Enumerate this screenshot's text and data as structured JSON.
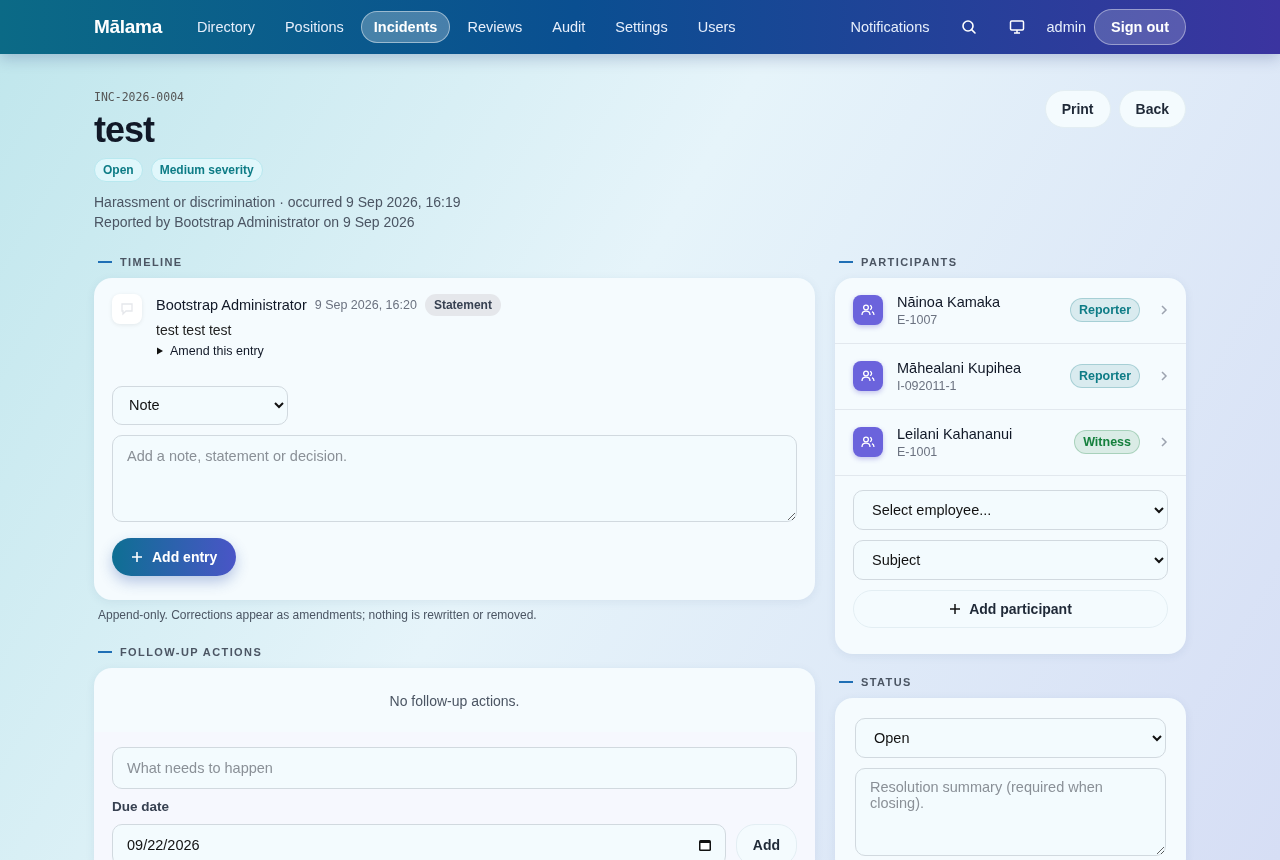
{
  "nav": {
    "brand": "Mālama",
    "items": [
      {
        "label": "Directory",
        "selected": false
      },
      {
        "label": "Positions",
        "selected": false
      },
      {
        "label": "Incidents",
        "selected": true
      },
      {
        "label": "Reviews",
        "selected": false
      },
      {
        "label": "Audit",
        "selected": false
      },
      {
        "label": "Settings",
        "selected": false
      },
      {
        "label": "Users",
        "selected": false
      }
    ],
    "notifications": "Notifications",
    "user": "admin",
    "sign_out": "Sign out"
  },
  "header": {
    "ref": "INC-2026-0004",
    "title": "test",
    "badges": [
      "Open",
      "Medium severity"
    ],
    "meta": "Harassment or discrimination · occurred 9 Sep 2026, 16:19",
    "reported": "Reported by Bootstrap Administrator on 9 Sep 2026",
    "actions": [
      "Print",
      "Back"
    ]
  },
  "timeline": {
    "heading": "TIMELINE",
    "entries": [
      {
        "author": "Bootstrap Administrator",
        "time": "9 Sep 2026, 16:20",
        "type": "Statement",
        "text": "test test test",
        "amend": "Amend this entry"
      }
    ],
    "entry_type": "Note",
    "placeholder": "Add a note, statement or decision.",
    "add_button": "Add entry",
    "footnote": "Append-only. Corrections appear as amendments; nothing is rewritten or removed."
  },
  "followup": {
    "heading": "FOLLOW-UP ACTIONS",
    "empty": "No follow-up actions.",
    "placeholder": "What needs to happen",
    "due_label": "Due date",
    "due_value": "09/22/2026",
    "add_button": "Add"
  },
  "participants": {
    "heading": "PARTICIPANTS",
    "items": [
      {
        "name": "Nāinoa Kamaka",
        "id": "E-1007",
        "role": "Reporter",
        "color": "#0e7c86"
      },
      {
        "name": "Māhealani Kupihea",
        "id": "I-092011-1",
        "role": "Reporter",
        "color": "#0e7c86"
      },
      {
        "name": "Leilani Kahananui",
        "id": "E-1001",
        "role": "Witness",
        "color": "#15803d"
      }
    ],
    "employee_select": "Select employee...",
    "role_select": "Subject",
    "add_button": "Add participant"
  },
  "status": {
    "heading": "STATUS",
    "value": "Open",
    "placeholder": "Resolution summary (required when closing)."
  }
}
